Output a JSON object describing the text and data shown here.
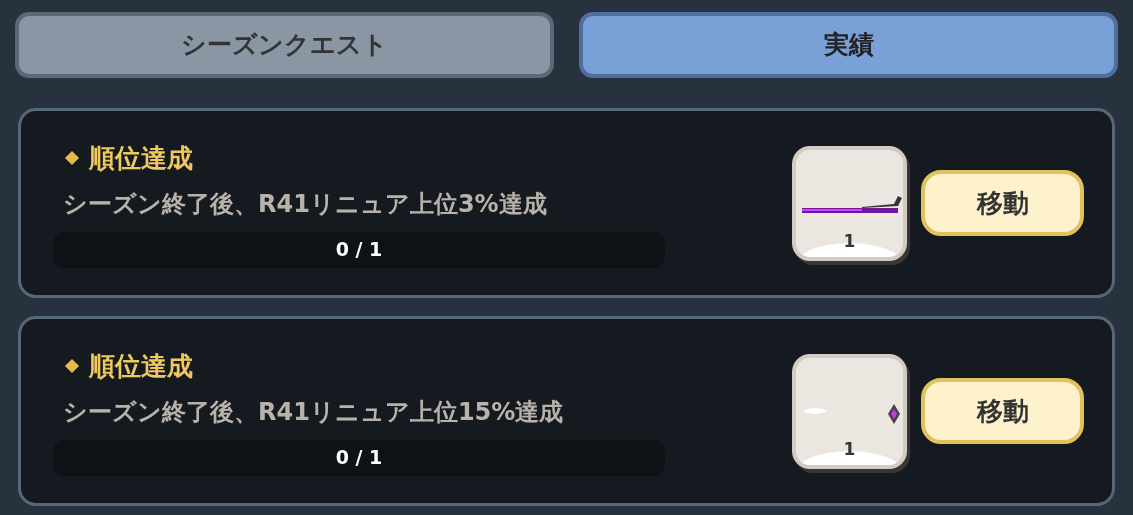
{
  "tabs": [
    {
      "label": "シーズンクエスト",
      "selected": false
    },
    {
      "label": "実績",
      "selected": true
    }
  ],
  "quests": [
    {
      "title": "順位達成",
      "description": "シーズン終了後、R41リニュア上位3%達成",
      "progress": "0 / 1",
      "level": 0,
      "reward": {
        "kind": "sword",
        "count": "1"
      },
      "button": "移動"
    },
    {
      "title": "順位達成",
      "description": "シーズン終了後、R41リニュア上位15%達成",
      "progress": "0 / 1",
      "level": 0,
      "reward": {
        "kind": "gem",
        "count": "1"
      },
      "button": "移動"
    }
  ]
}
